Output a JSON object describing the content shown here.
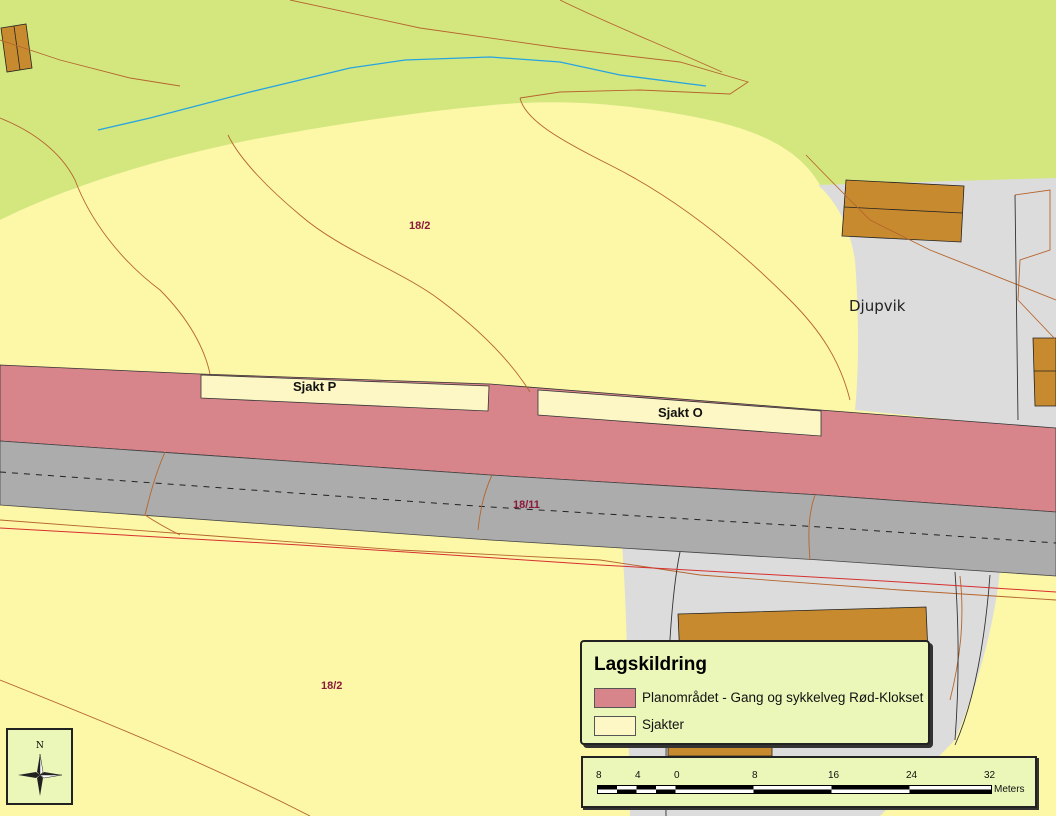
{
  "map": {
    "parcels": [
      {
        "label": "18/2"
      },
      {
        "label": "18/11"
      },
      {
        "label": "18/2"
      }
    ],
    "place_name": "Djupvik",
    "shafts": [
      {
        "label": "Sjakt P"
      },
      {
        "label": "Sjakt O"
      }
    ],
    "colors": {
      "field": "#fdf7a8",
      "forest": "#d4e77f",
      "plan_area": "#d7858b",
      "road": "#acacac",
      "built_area": "#dcdcdc",
      "building": "#c88a2e",
      "contour": "#b5652e",
      "stream": "#27a3e0",
      "boundary": "#d63030"
    }
  },
  "legend": {
    "title": "Lagskildring",
    "items": [
      {
        "label": "Planområdet - Gang og sykkelveg Rød-Klokset",
        "color": "#d7858b"
      },
      {
        "label": "Sjakter",
        "color": "#fdf7c6"
      }
    ]
  },
  "north_arrow": {
    "letter": "N"
  },
  "scalebar": {
    "ticks": [
      "8",
      "4",
      "0",
      "8",
      "16",
      "24",
      "32"
    ],
    "unit": "Meters"
  }
}
